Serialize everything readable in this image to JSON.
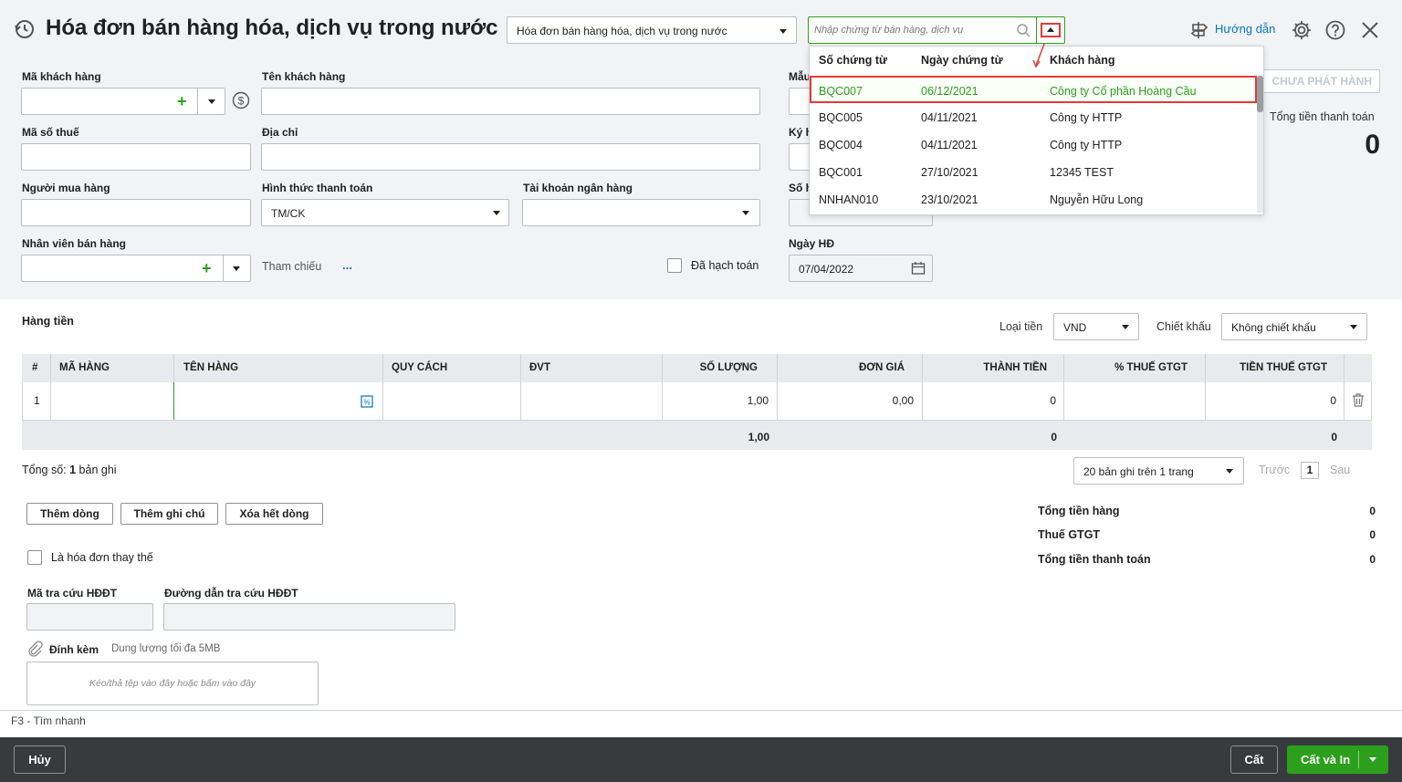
{
  "header": {
    "title": "Hóa đơn bán hàng hóa, dịch vụ trong nước",
    "type_select": "Hóa đơn bán hàng hóa, dịch vụ trong nước",
    "search_placeholder": "Nhập chứng từ bán hàng, dịch vụ",
    "help": "Hướng dẫn"
  },
  "form": {
    "ma_kh": "Mã khách hàng",
    "ten_kh": "Tên khách hàng",
    "mst": "Mã số thuế",
    "dia_chi": "Địa chỉ",
    "nguoi_mua": "Người mua hàng",
    "httt": "Hình thức thanh toán",
    "httt_value": "TM/CK",
    "tk_nh": "Tài khoản ngân hàng",
    "nvbh": "Nhân viên bán hàng",
    "tham_chieu": "Tham chiếu",
    "tham_chieu_more": "...",
    "da_hach_toan": "Đã hạch toán",
    "mau": "Mẫu",
    "ky": "Ký h",
    "so": "Số h",
    "ngay_hd": "Ngày HĐ",
    "ngay_hd_value": "07/04/2022",
    "status": "CHƯA PHÁT HÀNH",
    "tong_tt_label": "Tổng tiền thanh toán",
    "tong_tt_value": "0"
  },
  "dropdown": {
    "headers": [
      "Số chứng từ",
      "Ngày chứng từ",
      "Khách hàng"
    ],
    "rows": [
      {
        "so": "BQC007",
        "ngay": "06/12/2021",
        "kh": "Công ty Cổ phần Hoàng Cầu"
      },
      {
        "so": "BQC005",
        "ngay": "04/11/2021",
        "kh": "Công ty HTTP"
      },
      {
        "so": "BQC004",
        "ngay": "04/11/2021",
        "kh": "Công ty HTTP"
      },
      {
        "so": "BQC001",
        "ngay": "27/10/2021",
        "kh": "12345 TEST"
      },
      {
        "so": "NNHAN010",
        "ngay": "23/10/2021",
        "kh": "Nguyễn Hữu Long"
      }
    ]
  },
  "items": {
    "title": "Hàng tiền",
    "loai_tien": "Loại tiền",
    "loai_tien_value": "VND",
    "chiet_khau": "Chiết khấu",
    "chiet_khau_value": "Không chiết khấu",
    "columns": [
      "#",
      "MÃ HÀNG",
      "TÊN HÀNG",
      "QUY CÁCH",
      "ĐVT",
      "SỐ LƯỢNG",
      "ĐƠN GIÁ",
      "THÀNH TIỀN",
      "% THUẾ GTGT",
      "TIỀN THUẾ GTGT"
    ],
    "row": {
      "stt": "1",
      "so_luong": "1,00",
      "don_gia": "0,00",
      "thanh_tien": "0",
      "tien_thue": "0"
    },
    "totals": {
      "so_luong": "1,00",
      "thanh_tien": "0",
      "tien_thue": "0"
    },
    "record_prefix": "Tổng số: ",
    "record_count": "1",
    "record_suffix": " bản ghi",
    "page_size": "20 bản ghi trên 1 trang",
    "prev": "Trước",
    "page": "1",
    "next": "Sau"
  },
  "buttons": {
    "add_row": "Thêm dòng",
    "add_note": "Thêm ghi chú",
    "delete_all": "Xóa hết dòng",
    "cancel": "Hủy",
    "save": "Cất",
    "save_print": "Cất và In"
  },
  "summary": {
    "tong_tien_hang": "Tổng tiền hàng",
    "tong_tien_hang_v": "0",
    "thue": "Thuế GTGT",
    "thue_v": "0",
    "tong_tt": "Tổng tiền thanh toán",
    "tong_tt_v": "0"
  },
  "extra": {
    "thay_the": "Là hóa đơn thay thế",
    "ma_tra_cuu": "Mã tra cứu HĐĐT",
    "duong_dan": "Đường dẫn tra cứu HĐĐT",
    "dinh_kem": "Đính kèm",
    "dung_luong": "Dung lượng tối đa 5MB",
    "drop_hint": "Kéo/thả tệp vào đây hoặc bấm vào đây"
  },
  "hotkey": "F3 - Tìm nhanh",
  "colors": {
    "accent": "#2ca01c",
    "highlight": "#e53935",
    "link": "#0075c0"
  }
}
